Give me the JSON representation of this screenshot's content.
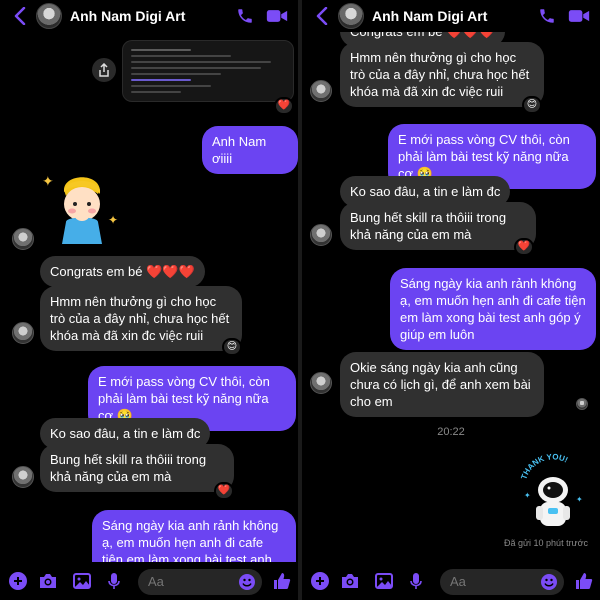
{
  "contact": {
    "name": "Anh Nam Digi Art"
  },
  "colors": {
    "accent": "#7b4cf6",
    "outgoing": "#6b44f2",
    "incoming": "#303030",
    "background": "#000000"
  },
  "icons": [
    "chevron-left-icon",
    "phone-icon",
    "video-icon",
    "share-icon",
    "plus-icon",
    "camera-icon",
    "image-icon",
    "mic-icon",
    "emoji-icon",
    "like-icon"
  ],
  "composer": {
    "placeholder": "Aa"
  },
  "left": {
    "messages": {
      "m1": "Anh Nam ơiiii",
      "m2": "Congrats em bé ❤️❤️❤️",
      "m3": "Hmm nên thưởng gì cho học trò của a đây nhỉ, chưa học hết khóa mà đã xin đc việc ruii",
      "m4": "E mới pass vòng CV thôi, còn phải làm bài test kỹ năng nữa cơ 🥹",
      "m5": "Ko sao đâu, a tin e làm đc",
      "m6": "Bung hết skill ra thôiii trong khả năng của em mà",
      "m7": "Sáng ngày kia anh rảnh không ạ, em muốn hẹn anh đi cafe tiện em làm xong bài test anh góp ý giúp"
    },
    "reactions": {
      "r1": "❤️",
      "r2": "😊",
      "r3": "❤️"
    }
  },
  "right": {
    "messages": {
      "m0": "Congrats em bé ❤️❤️❤️",
      "m1": "Hmm nên thưởng gì cho học trò của a đây nhỉ, chưa học hết khóa mà đã xin đc việc ruii",
      "m2": "E mới pass vòng CV thôi, còn phải làm bài test kỹ năng nữa cơ 🥹",
      "m3": "Ko sao đâu, a tin e làm đc",
      "m4": "Bung hết skill ra thôiii trong khả năng của em mà",
      "m5": "Sáng ngày kia anh rảnh không ạ, em muốn hẹn anh đi cafe tiện em làm xong bài test anh góp ý giúp em luôn",
      "m6": "Okie sáng ngày kia anh cũng chưa có lịch gì, để anh xem bài cho em"
    },
    "reactions": {
      "r1": "😊",
      "r2": "❤️"
    },
    "timestamp": "20:22",
    "sticker_text": "THANK YOU!",
    "sent_status": "Đã gửi 10 phút trước"
  }
}
